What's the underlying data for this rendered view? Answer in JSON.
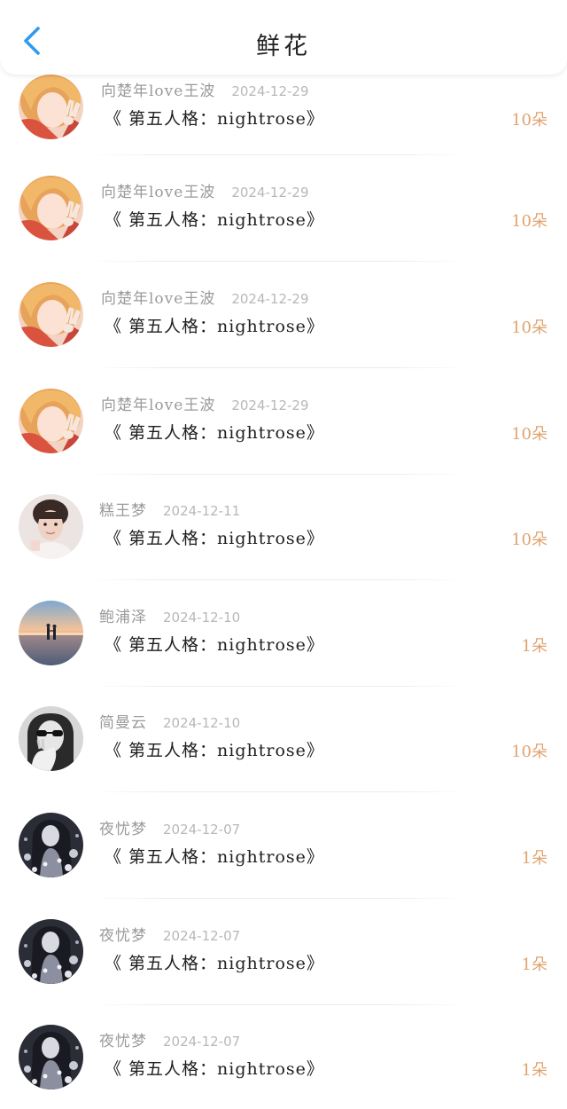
{
  "header": {
    "title": "鲜花",
    "back_icon": "chevron-left-icon",
    "back_color": "#2f9bf0"
  },
  "accent": {
    "count_color": "#e0a36e"
  },
  "entries": [
    {
      "name": "向楚年love王波",
      "date": "2024-12-29",
      "work": "《 第五人格：nightrose》",
      "count": "10朵",
      "avatar": "anime-blonde-peace"
    },
    {
      "name": "向楚年love王波",
      "date": "2024-12-29",
      "work": "《 第五人格：nightrose》",
      "count": "10朵",
      "avatar": "anime-blonde-peace"
    },
    {
      "name": "向楚年love王波",
      "date": "2024-12-29",
      "work": "《 第五人格：nightrose》",
      "count": "10朵",
      "avatar": "anime-blonde-peace"
    },
    {
      "name": "向楚年love王波",
      "date": "2024-12-29",
      "work": "《 第五人格：nightrose》",
      "count": "10朵",
      "avatar": "anime-blonde-peace"
    },
    {
      "name": "糕王梦",
      "date": "2024-12-11",
      "work": "《 第五人格：nightrose》",
      "count": "10朵",
      "avatar": "photo-boy"
    },
    {
      "name": "鲍浦泽",
      "date": "2024-12-10",
      "work": "《 第五人格：nightrose》",
      "count": "1朵",
      "avatar": "sunset-couple"
    },
    {
      "name": "简曼云",
      "date": "2024-12-10",
      "work": "《 第五人格：nightrose》",
      "count": "10朵",
      "avatar": "bw-sunglasses"
    },
    {
      "name": "夜忧梦",
      "date": "2024-12-07",
      "work": "《 第五人格：nightrose》",
      "count": "1朵",
      "avatar": "dark-anime-girl"
    },
    {
      "name": "夜忧梦",
      "date": "2024-12-07",
      "work": "《 第五人格：nightrose》",
      "count": "1朵",
      "avatar": "dark-anime-girl"
    },
    {
      "name": "夜忧梦",
      "date": "2024-12-07",
      "work": "《 第五人格：nightrose》",
      "count": "1朵",
      "avatar": "dark-anime-girl"
    }
  ]
}
